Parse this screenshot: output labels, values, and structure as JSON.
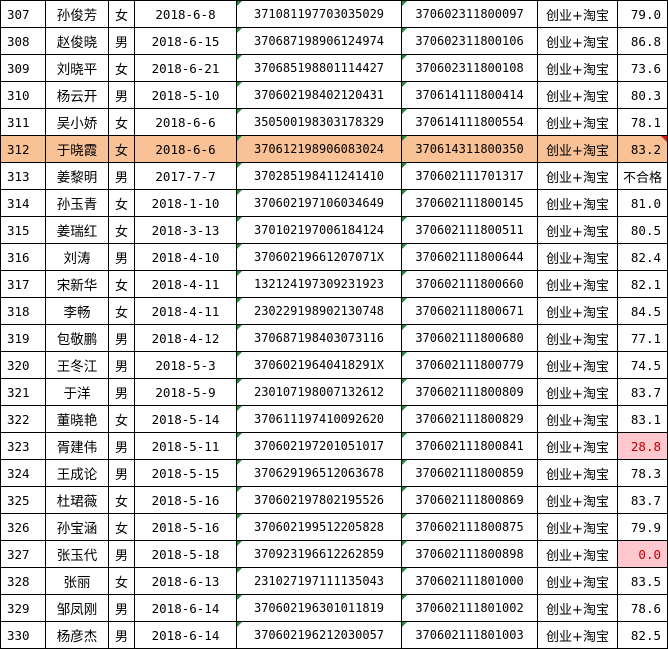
{
  "rows": [
    {
      "id": "307",
      "name": "孙俊芳",
      "sex": "女",
      "date": "2018-6-8",
      "idno": "371081197703035029",
      "cert": "370602311800097",
      "type": "创业+淘宝",
      "score": "79.0"
    },
    {
      "id": "308",
      "name": "赵俊晓",
      "sex": "男",
      "date": "2018-6-15",
      "idno": "370687198906124974",
      "cert": "370602311800106",
      "type": "创业+淘宝",
      "score": "86.8"
    },
    {
      "id": "309",
      "name": "刘晓平",
      "sex": "女",
      "date": "2018-6-21",
      "idno": "370685198801114427",
      "cert": "370602311800108",
      "type": "创业+淘宝",
      "score": "73.6"
    },
    {
      "id": "310",
      "name": "杨云开",
      "sex": "男",
      "date": "2018-5-10",
      "idno": "370602198402120431",
      "cert": "370614111800414",
      "type": "创业+淘宝",
      "score": "80.3"
    },
    {
      "id": "311",
      "name": "吴小娇",
      "sex": "女",
      "date": "2018-6-6",
      "idno": "350500198303178329",
      "cert": "370614111800554",
      "type": "创业+淘宝",
      "score": "78.1"
    },
    {
      "id": "312",
      "name": "于晓霞",
      "sex": "女",
      "date": "2018-6-6",
      "idno": "370612198906083024",
      "cert": "370614311800350",
      "type": "创业+淘宝",
      "score": "83.2"
    },
    {
      "id": "313",
      "name": "姜黎明",
      "sex": "男",
      "date": "2017-7-7",
      "idno": "370285198411241410",
      "cert": "370602111701317",
      "type": "创业+淘宝",
      "score": "不合格"
    },
    {
      "id": "314",
      "name": "孙玉青",
      "sex": "女",
      "date": "2018-1-10",
      "idno": "370602197106034649",
      "cert": "370602111800145",
      "type": "创业+淘宝",
      "score": "81.0"
    },
    {
      "id": "315",
      "name": "姜瑞红",
      "sex": "女",
      "date": "2018-3-13",
      "idno": "370102197006184124",
      "cert": "370602111800511",
      "type": "创业+淘宝",
      "score": "80.5"
    },
    {
      "id": "316",
      "name": "刘涛",
      "sex": "男",
      "date": "2018-4-10",
      "idno": "37060219661207071X",
      "cert": "370602111800644",
      "type": "创业+淘宝",
      "score": "82.4"
    },
    {
      "id": "317",
      "name": "宋新华",
      "sex": "女",
      "date": "2018-4-11",
      "idno": "132124197309231923",
      "cert": "370602111800660",
      "type": "创业+淘宝",
      "score": "82.1"
    },
    {
      "id": "318",
      "name": "李畅",
      "sex": "女",
      "date": "2018-4-11",
      "idno": "230229198902130748",
      "cert": "370602111800671",
      "type": "创业+淘宝",
      "score": "84.5"
    },
    {
      "id": "319",
      "name": "包敬鹏",
      "sex": "男",
      "date": "2018-4-12",
      "idno": "370687198403073116",
      "cert": "370602111800680",
      "type": "创业+淘宝",
      "score": "77.1"
    },
    {
      "id": "320",
      "name": "王冬江",
      "sex": "男",
      "date": "2018-5-3",
      "idno": "37060219640418291X",
      "cert": "370602111800779",
      "type": "创业+淘宝",
      "score": "74.5"
    },
    {
      "id": "321",
      "name": "于洋",
      "sex": "男",
      "date": "2018-5-9",
      "idno": "230107198007132612",
      "cert": "370602111800809",
      "type": "创业+淘宝",
      "score": "83.7"
    },
    {
      "id": "322",
      "name": "董晓艳",
      "sex": "女",
      "date": "2018-5-14",
      "idno": "370611197410092620",
      "cert": "370602111800829",
      "type": "创业+淘宝",
      "score": "83.1"
    },
    {
      "id": "323",
      "name": "胥建伟",
      "sex": "男",
      "date": "2018-5-11",
      "idno": "370602197201051017",
      "cert": "370602111800841",
      "type": "创业+淘宝",
      "score": "28.8"
    },
    {
      "id": "324",
      "name": "王成论",
      "sex": "男",
      "date": "2018-5-15",
      "idno": "370629196512063678",
      "cert": "370602111800859",
      "type": "创业+淘宝",
      "score": "78.3"
    },
    {
      "id": "325",
      "name": "杜珺薇",
      "sex": "女",
      "date": "2018-5-16",
      "idno": "370602197802195526",
      "cert": "370602111800869",
      "type": "创业+淘宝",
      "score": "83.7"
    },
    {
      "id": "326",
      "name": "孙宝涵",
      "sex": "女",
      "date": "2018-5-16",
      "idno": "370602199512205828",
      "cert": "370602111800875",
      "type": "创业+淘宝",
      "score": "79.9"
    },
    {
      "id": "327",
      "name": "张玉代",
      "sex": "男",
      "date": "2018-5-18",
      "idno": "370923196612262859",
      "cert": "370602111800898",
      "type": "创业+淘宝",
      "score": "0.0"
    },
    {
      "id": "328",
      "name": "张丽",
      "sex": "女",
      "date": "2018-6-13",
      "idno": "231027197111135043",
      "cert": "370602111801000",
      "type": "创业+淘宝",
      "score": "83.5"
    },
    {
      "id": "329",
      "name": "邹凤刚",
      "sex": "男",
      "date": "2018-6-14",
      "idno": "370602196301011819",
      "cert": "370602111801002",
      "type": "创业+淘宝",
      "score": "78.6"
    },
    {
      "id": "330",
      "name": "杨彦杰",
      "sex": "男",
      "date": "2018-6-14",
      "idno": "370602196212030057",
      "cert": "370602111801003",
      "type": "创业+淘宝",
      "score": "82.5"
    }
  ],
  "colors": {
    "highlight_row": "#f8c196",
    "red_text": "#e01010",
    "low_score_fill": "#ffc7ce",
    "error_indicator": "#1f8a3a"
  }
}
